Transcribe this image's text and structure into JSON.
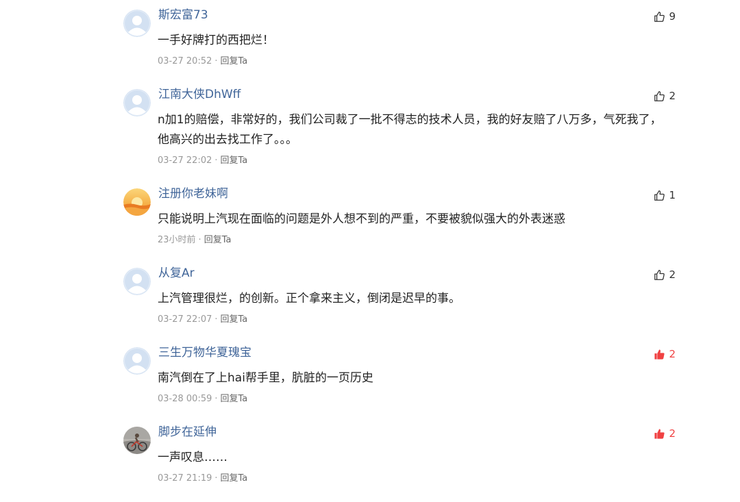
{
  "colors": {
    "username": "#406599",
    "text": "#222222",
    "meta": "#999999",
    "liked": "#f04142",
    "like_outline": "#333333"
  },
  "comments": [
    {
      "username": "斯宏富73",
      "content": "一手好牌打的西把烂！",
      "time": "03-27 20:52",
      "reply": "回复Ta",
      "likes": "9",
      "liked": false,
      "avatar_icon": "default-avatar-icon"
    },
    {
      "username": "江南大侠DhWff",
      "content": "n加1的赔偿，非常好的，我们公司裁了一批不得志的技术人员，我的好友赔了八万多，气死我了，他高兴的出去找工作了。。。",
      "time": "03-27 22:02",
      "reply": "回复Ta",
      "likes": "2",
      "liked": false,
      "avatar_icon": "default-avatar-icon"
    },
    {
      "username": "注册你老妹啊",
      "content": "只能说明上汽现在面临的问题是外人想不到的严重，不要被貌似强大的外表迷惑",
      "time": "23小时前",
      "reply": "回复Ta",
      "likes": "1",
      "liked": false,
      "avatar_icon": "sunset-avatar-icon"
    },
    {
      "username": "从复Ar",
      "content": "上汽管理很烂，的创新。正个拿来主义，倒闭是迟早的事。",
      "time": "03-27 22:07",
      "reply": "回复Ta",
      "likes": "2",
      "liked": false,
      "avatar_icon": "default-avatar-icon"
    },
    {
      "username": "三生万物华夏瑰宝",
      "content": "南汽倒在了上hai帮手里，肮脏的一页历史",
      "time": "03-28 00:59",
      "reply": "回复Ta",
      "likes": "2",
      "liked": true,
      "avatar_icon": "default-avatar-icon"
    },
    {
      "username": "脚步在延伸",
      "content": "一声叹息……",
      "time": "03-27 21:19",
      "reply": "回复Ta",
      "likes": "2",
      "liked": true,
      "avatar_icon": "photo-avatar-icon"
    }
  ]
}
